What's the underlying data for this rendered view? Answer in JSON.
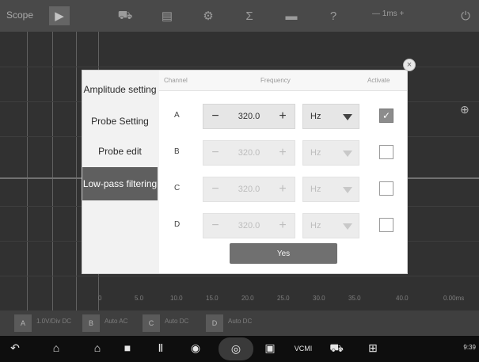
{
  "app": {
    "title": "Scope"
  },
  "toolbar": {
    "icons": [
      "play-icon",
      "car-icon",
      "memory-icon",
      "gear-icon",
      "sum-icon",
      "folder-icon",
      "help-icon"
    ],
    "timebase": "— 1ms +"
  },
  "dialog": {
    "menu": [
      {
        "label": "Amplitude setting",
        "active": false
      },
      {
        "label": "Probe Setting",
        "active": false
      },
      {
        "label": "Probe edit",
        "active": false
      },
      {
        "label": "Low-pass filtering",
        "active": true
      }
    ],
    "columns": {
      "channel": "Channel",
      "frequency": "Frequency",
      "activate": "Activate"
    },
    "channels": [
      {
        "letter": "A",
        "value": "320.0",
        "unit": "Hz",
        "checked": true,
        "enabled": true
      },
      {
        "letter": "B",
        "value": "320.0",
        "unit": "Hz",
        "checked": false,
        "enabled": false
      },
      {
        "letter": "C",
        "value": "320.0",
        "unit": "Hz",
        "checked": false,
        "enabled": false
      },
      {
        "letter": "D",
        "value": "320.0",
        "unit": "Hz",
        "checked": false,
        "enabled": false
      }
    ],
    "confirm_label": "Yes"
  },
  "bottom": {
    "channels": [
      {
        "label": "A",
        "info": "1.0V/Div DC"
      },
      {
        "label": "B",
        "info": "Auto AC"
      },
      {
        "label": "C",
        "info": "Auto DC"
      },
      {
        "label": "D",
        "info": "Auto DC"
      }
    ],
    "scale": [
      "0",
      "5.0",
      "10.0",
      "15.0",
      "20.0",
      "25.0",
      "30.0",
      "35.0",
      "40.0"
    ],
    "right_label": "0.00ms"
  },
  "navbar": {
    "icons": [
      "back-icon",
      "home-icon",
      "house-icon",
      "stop-icon",
      "pause-icon",
      "chrome-icon",
      "camera-icon",
      "record-icon",
      "vcmi-icon",
      "vehicle-icon",
      "network-icon"
    ],
    "vcmi_label": "VCMI",
    "status": "9:39"
  }
}
